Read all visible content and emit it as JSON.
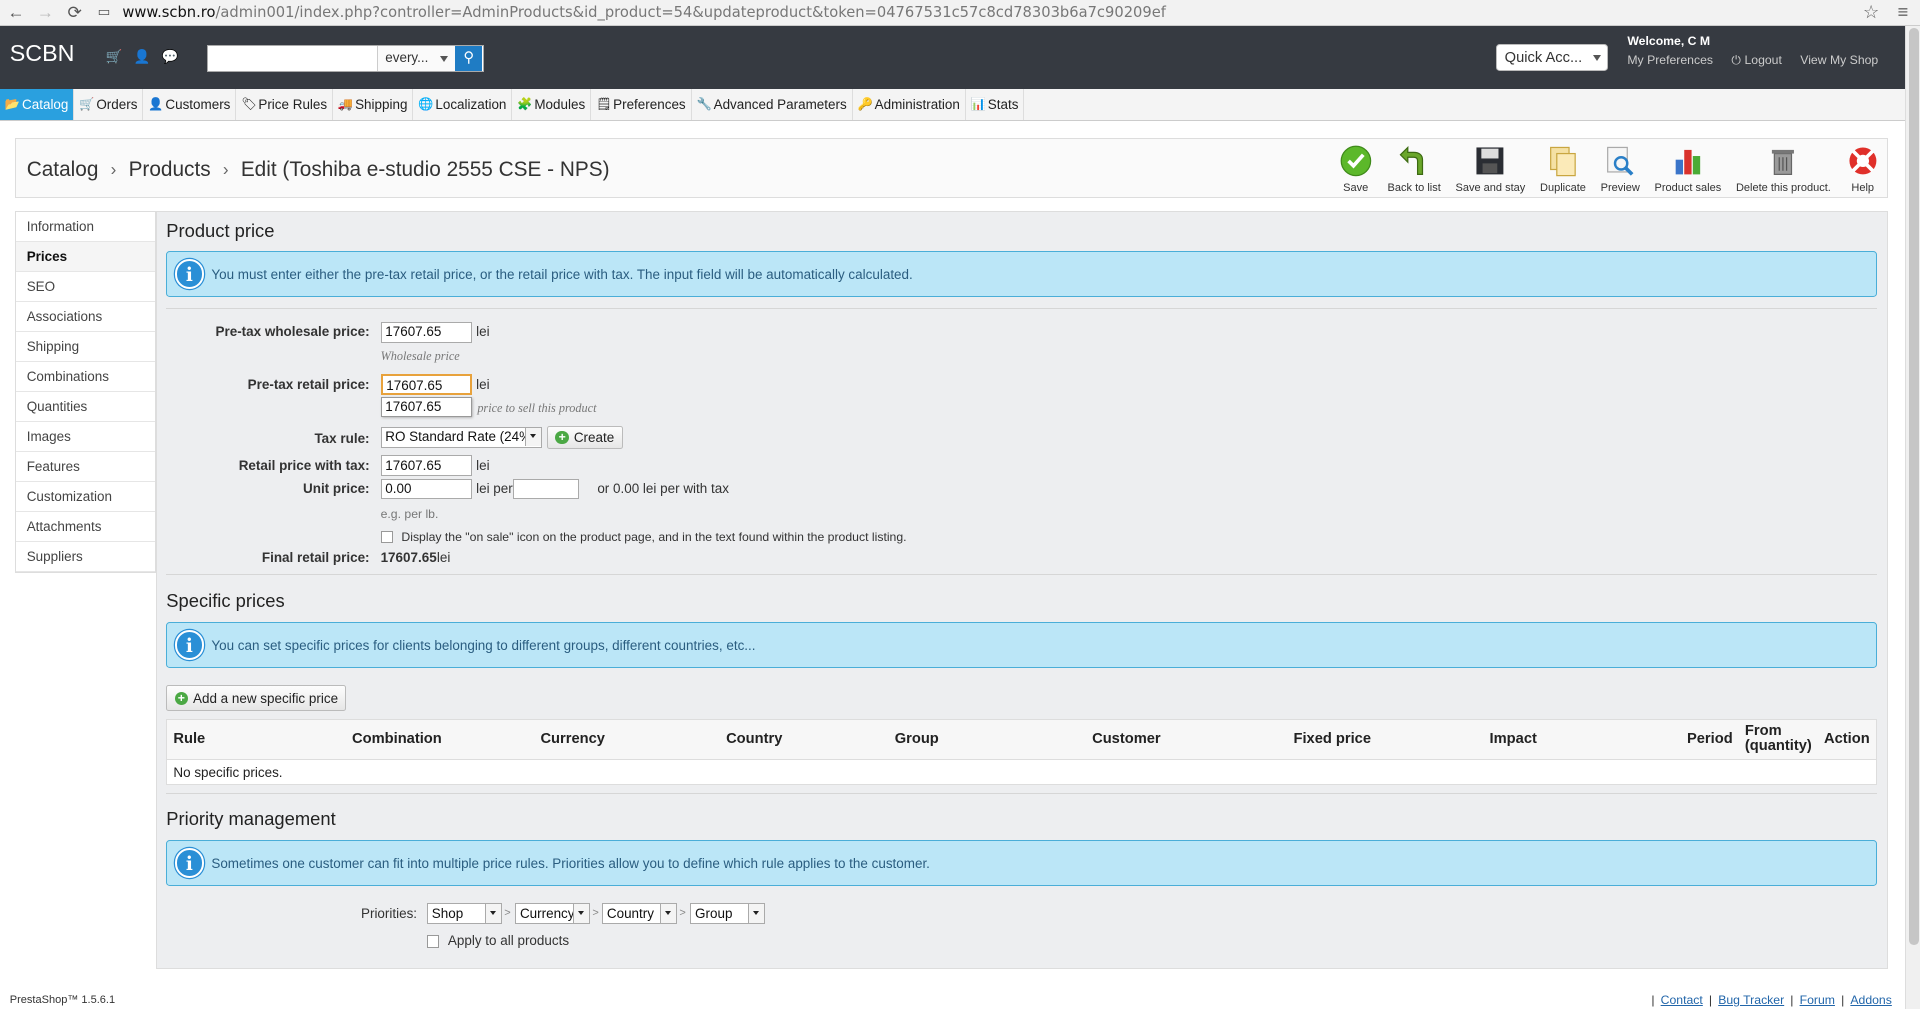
{
  "browser": {
    "host": "www.scbn.ro",
    "path": "/admin001/index.php?controller=AdminProducts&id_product=54&updateproduct&token=04767531c57c8cd78303b6a7c90209ef"
  },
  "header": {
    "logo": "SCBN",
    "search_placeholder": "",
    "search_scope": "every...",
    "quick_access": "Quick Acc...",
    "welcome": "Welcome, C M",
    "my_preferences": "My Preferences",
    "logout": "Logout",
    "view_shop": "View My Shop"
  },
  "menu": [
    {
      "label": "Catalog"
    },
    {
      "label": "Orders"
    },
    {
      "label": "Customers"
    },
    {
      "label": "Price Rules"
    },
    {
      "label": "Shipping"
    },
    {
      "label": "Localization"
    },
    {
      "label": "Modules"
    },
    {
      "label": "Preferences"
    },
    {
      "label": "Advanced Parameters"
    },
    {
      "label": "Administration"
    },
    {
      "label": "Stats"
    }
  ],
  "breadcrumb": {
    "c1": "Catalog",
    "c2": "Products",
    "c3": "Edit (Toshiba e-studio 2555 CSE - NPS)"
  },
  "toolbar": {
    "save": "Save",
    "back": "Back to list",
    "save_stay": "Save and stay",
    "duplicate": "Duplicate",
    "preview": "Preview",
    "sales": "Product sales",
    "delete": "Delete this product.",
    "help": "Help"
  },
  "sidebar": [
    "Information",
    "Prices",
    "SEO",
    "Associations",
    "Shipping",
    "Combinations",
    "Quantities",
    "Images",
    "Features",
    "Customization",
    "Attachments",
    "Suppliers"
  ],
  "product_price": {
    "title": "Product price",
    "info": "You must enter either the pre-tax retail price, or the retail price with tax. The input field will be automatically calculated.",
    "wholesale_label": "Pre-tax wholesale price:",
    "wholesale_value": "17607.65",
    "currency": "lei",
    "wholesale_hint": "Wholesale price",
    "retail_label": "Pre-tax retail price:",
    "retail_value": "17607.65",
    "autocomplete": "17607.65",
    "retail_hint": "price to sell this product",
    "tax_label": "Tax rule:",
    "tax_value": "RO Standard Rate (24%)",
    "create": "Create",
    "with_tax_label": "Retail price with tax:",
    "with_tax_value": "17607.65",
    "unit_label": "Unit price:",
    "unit_value": "0.00",
    "unit_per": "lei per",
    "unit_suffix": "or 0.00 lei per with tax",
    "unit_hint": "e.g. per lb.",
    "on_sale": "Display the \"on sale\" icon on the product page, and in the text found within the product listing.",
    "final_label": "Final retail price:",
    "final_value": "17607.65",
    "final_currency": "lei"
  },
  "specific": {
    "title": "Specific prices",
    "info": "You can set specific prices for clients belonging to different groups, different countries, etc...",
    "add": "Add a new specific price",
    "columns": [
      "Rule",
      "Combination",
      "Currency",
      "Country",
      "Group",
      "Customer",
      "Fixed price",
      "Impact",
      "Period",
      "From (quantity)",
      "Action"
    ],
    "empty": "No specific prices."
  },
  "priority": {
    "title": "Priority management",
    "info": "Sometimes one customer can fit into multiple price rules. Priorities allow you to define which rule applies to the customer.",
    "label": "Priorities:",
    "p1": "Shop",
    "p2": "Currency",
    "p3": "Country",
    "p4": "Group",
    "sep": ">",
    "apply_all": "Apply to all products"
  },
  "footer": {
    "version": "PrestaShop™ 1.5.6.1",
    "links": [
      "Contact",
      "Bug Tracker",
      "Forum",
      "Addons"
    ],
    "sep": "|"
  }
}
